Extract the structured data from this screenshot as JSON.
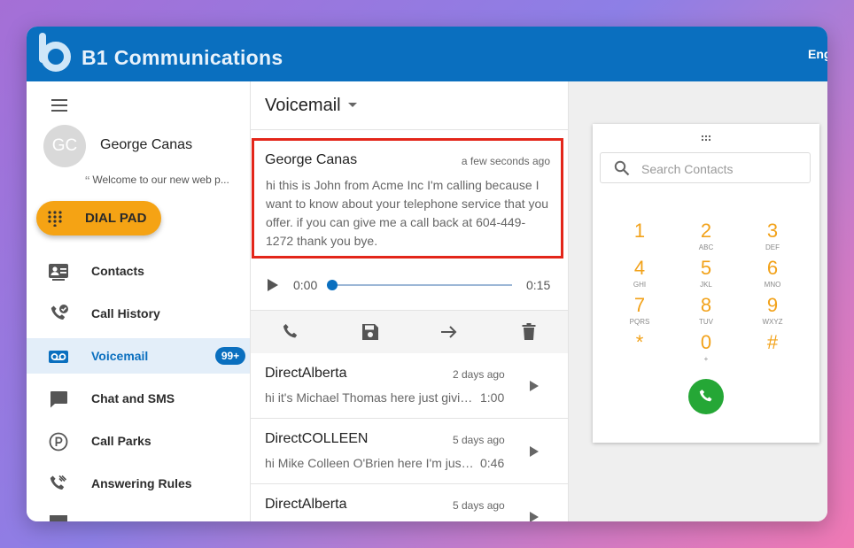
{
  "header": {
    "brand": "B1 Communications",
    "lang": "Eng"
  },
  "sidebar": {
    "user": {
      "initials": "GC",
      "name": "George Canas",
      "welcome": "Welcome to our new web p..."
    },
    "dialpad_label": "DIAL PAD",
    "items": [
      {
        "label": "Contacts",
        "icon": "contacts-icon"
      },
      {
        "label": "Call History",
        "icon": "call-history-icon"
      },
      {
        "label": "Voicemail",
        "icon": "voicemail-icon",
        "badge": "99+",
        "active": true
      },
      {
        "label": "Chat and SMS",
        "icon": "chat-icon"
      },
      {
        "label": "Call Parks",
        "icon": "call-parks-icon"
      },
      {
        "label": "Answering Rules",
        "icon": "answering-rules-icon"
      }
    ]
  },
  "voicemail": {
    "title": "Voicemail",
    "selected": {
      "name": "George Canas",
      "time": "a few seconds ago",
      "transcript": "hi this is John from Acme Inc I'm calling because I want to know about your telephone service that you offer. if you can give me a call back at 604-449-1272 thank you bye.",
      "current_time": "0:00",
      "duration": "0:15",
      "progress": 0
    },
    "list": [
      {
        "name": "DirectAlberta",
        "time": "2 days ago",
        "preview": "hi it's Michael Thomas here just giving you a call",
        "duration": "1:00"
      },
      {
        "name": "DirectCOLLEEN",
        "time": "5 days ago",
        "preview": "hi Mike Colleen O'Brien here I'm just calling",
        "duration": "0:46"
      },
      {
        "name": "DirectAlberta",
        "time": "5 days ago",
        "preview": "",
        "duration": ""
      }
    ]
  },
  "dialer": {
    "search_placeholder": "Search Contacts",
    "keys": [
      {
        "digit": "1",
        "letters": ""
      },
      {
        "digit": "2",
        "letters": "ABC"
      },
      {
        "digit": "3",
        "letters": "DEF"
      },
      {
        "digit": "4",
        "letters": "GHI"
      },
      {
        "digit": "5",
        "letters": "JKL"
      },
      {
        "digit": "6",
        "letters": "MNO"
      },
      {
        "digit": "7",
        "letters": "PQRS"
      },
      {
        "digit": "8",
        "letters": "TUV"
      },
      {
        "digit": "9",
        "letters": "WXYZ"
      },
      {
        "digit": "*",
        "letters": ""
      },
      {
        "digit": "0",
        "letters": "+"
      },
      {
        "digit": "#",
        "letters": ""
      }
    ]
  },
  "colors": {
    "brand": "#0a6fbf",
    "accent": "#f5a314",
    "call": "#25a736",
    "highlight": "#e3261a"
  }
}
